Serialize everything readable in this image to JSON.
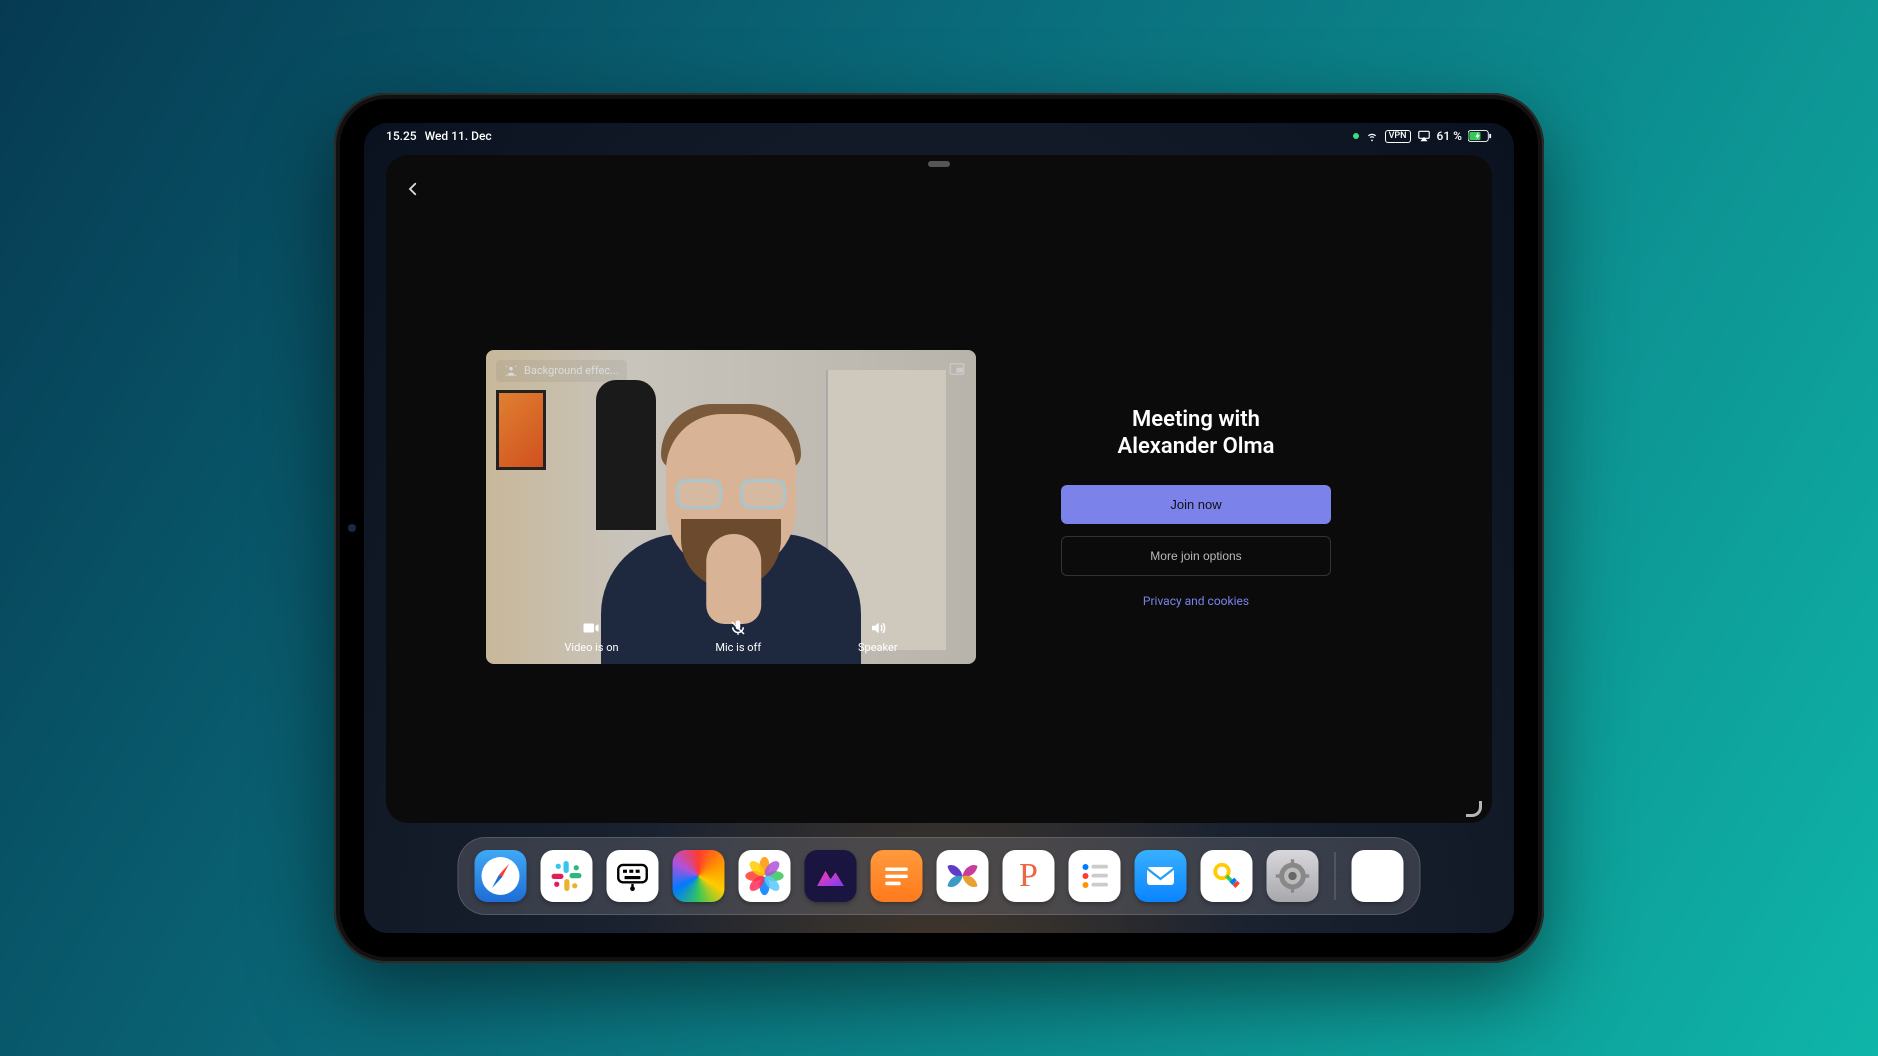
{
  "status_bar": {
    "time": "15.25",
    "date": "Wed 11. Dec",
    "vpn_label": "VPN",
    "battery_text": "61 %"
  },
  "meeting": {
    "title": "Meeting with\nAlexander Olma",
    "join_label": "Join now",
    "more_options_label": "More join options",
    "privacy_label": "Privacy and cookies",
    "background_effects_label": "Background effec...",
    "video_label": "Video is on",
    "mic_label": "Mic is off",
    "speaker_label": "Speaker"
  },
  "dock": {
    "apps": [
      {
        "name": "safari"
      },
      {
        "name": "slack"
      },
      {
        "name": "typing-app"
      },
      {
        "name": "colors-app"
      },
      {
        "name": "photos"
      },
      {
        "name": "luminar"
      },
      {
        "name": "notes-app"
      },
      {
        "name": "butterfly-app"
      },
      {
        "name": "p-app"
      },
      {
        "name": "reminders"
      },
      {
        "name": "mail"
      },
      {
        "name": "passwords"
      },
      {
        "name": "settings"
      }
    ]
  },
  "colors": {
    "accent": "#7b83eb"
  }
}
